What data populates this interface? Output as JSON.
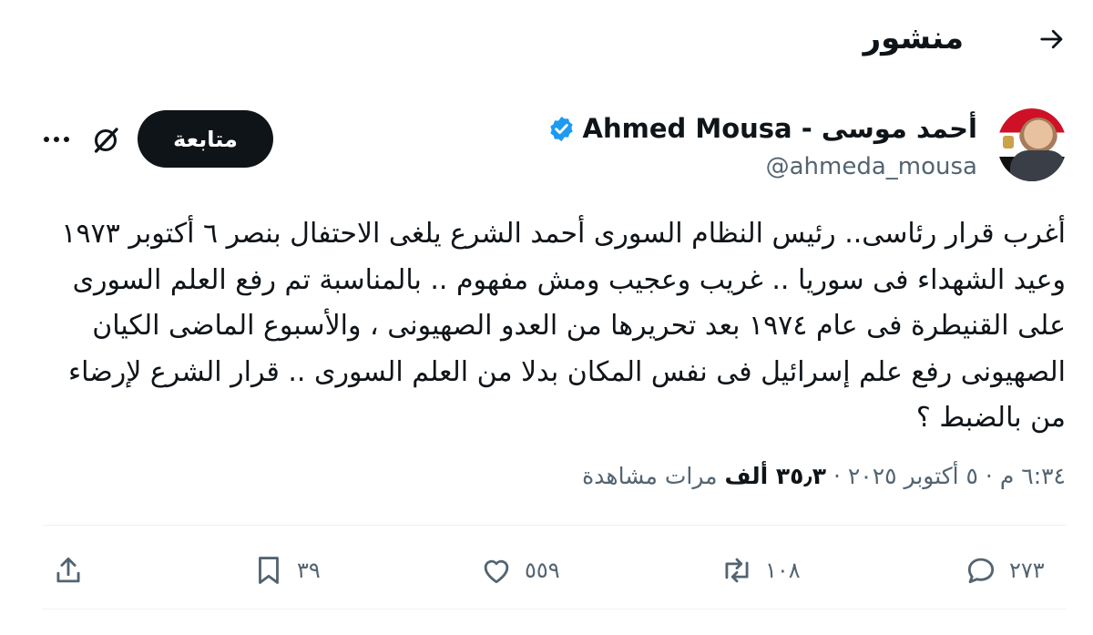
{
  "header": {
    "title": "منشور",
    "back_icon": "arrow-right-icon"
  },
  "author": {
    "name": "Ahmed Mousa - أحمد موسى",
    "handle": "@ahmeda_mousa",
    "verified": true,
    "follow_label": "متابعة"
  },
  "tweet": {
    "text": "أغرب قرار رئاسى.. رئيس النظام السورى أحمد الشرع يلغى الاحتفال بنصر ٦ أكتوبر ١٩٧٣ وعيد الشهداء فى سوريا .. غريب وعجيب ومش مفهوم .. بالمناسبة تم رفع العلم السورى على القنيطرة فى عام ١٩٧٤ بعد تحريرها من العدو الصهيونى ، والأسبوع الماضى الكيان الصهيونى رفع علم إسرائيل فى نفس المكان بدلا من العلم السورى .. قرار الشرع لإرضاء من بالضبط ؟",
    "time": "٦:٣٤ م",
    "date": "٥ أكتوبر ٢٠٢٥",
    "views_count": "٣٥٫٣ ألف",
    "views_label": "مرات مشاهدة"
  },
  "actions": {
    "replies": "٢٧٣",
    "reposts": "١٠٨",
    "likes": "٥٥٩",
    "bookmarks": "٣٩"
  },
  "colors": {
    "accent": "#1d9bf0",
    "text": "#0f1419",
    "muted": "#536471",
    "divider": "#eff3f4"
  }
}
